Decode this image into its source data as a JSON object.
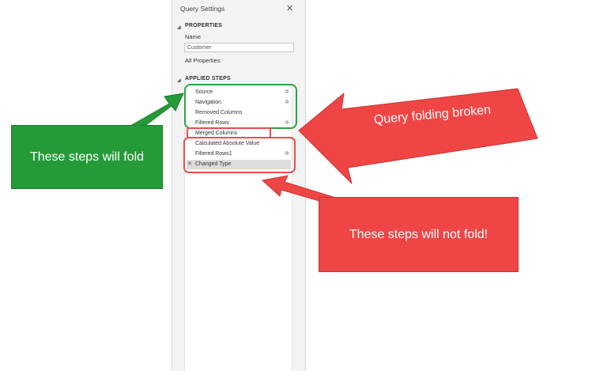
{
  "panel": {
    "title": "Query Settings",
    "close_glyph": "✕",
    "properties_header": "PROPERTIES",
    "name_label": "Name",
    "name_value": "Customer",
    "all_properties_link": "All Properties",
    "applied_steps_header": "APPLIED STEPS",
    "steps": [
      {
        "label": "Source",
        "has_gear": true
      },
      {
        "label": "Navigation",
        "has_gear": true
      },
      {
        "label": "Removed Columns",
        "has_gear": false
      },
      {
        "label": "Filtered Rows",
        "has_gear": true
      },
      {
        "label": "Merged Columns",
        "has_gear": false
      },
      {
        "label": "Calculated Absolute Value",
        "has_gear": false
      },
      {
        "label": "Filtered Rows1",
        "has_gear": true
      },
      {
        "label": "Changed Type",
        "has_gear": false,
        "selected": true
      }
    ],
    "gear_glyph": "✲",
    "delete_glyph": "✕"
  },
  "annotations": {
    "green_callout": "These steps will fold",
    "broken_callout": "Query folding broken",
    "not_fold_callout": "These steps will not fold!"
  },
  "colors": {
    "green": "#259a38",
    "red": "#f04545",
    "green_outline": "#2ea343",
    "red_outline": "#ee4c4c"
  }
}
